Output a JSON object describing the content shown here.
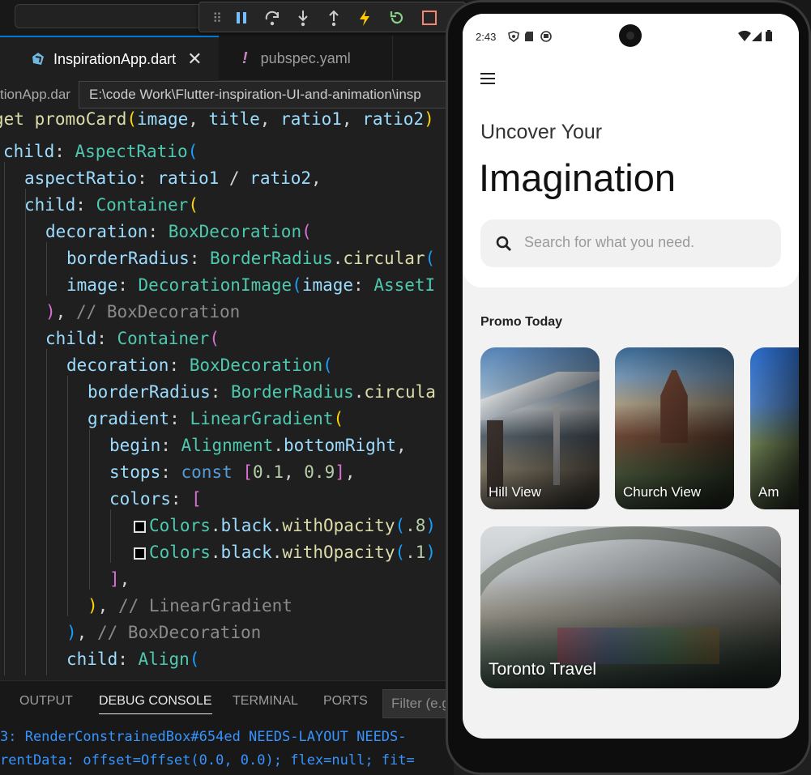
{
  "editor": {
    "tabs": [
      {
        "label": "InspirationApp.dart",
        "active": true
      },
      {
        "label": "pubspec.yaml",
        "active": false
      }
    ],
    "breadcrumb": "tionApp.dar",
    "tooltip": "E:\\code Work\\Flutter-inspiration-UI-and-animation\\insp",
    "code_lines": [
      "get promoCard(image, title, ratio1, ratio2)",
      "child: AspectRatio(",
      "aspectRatio: ratio1 / ratio2,",
      "child: Container(",
      "decoration: BoxDecoration(",
      "borderRadius: BorderRadius.circular(",
      "image: DecorationImage(image: AssetI",
      "), // BoxDecoration",
      "child: Container(",
      "decoration: BoxDecoration(",
      "borderRadius: BorderRadius.circula",
      "gradient: LinearGradient(",
      "begin: Alignment.bottomRight,",
      "stops: const [0.1, 0.9],",
      "colors: [",
      "Colors.black.withOpacity(.8)",
      "Colors.black.withOpacity(.1)",
      "],",
      "), // LinearGradient",
      "), // BoxDecoration",
      "child: Align("
    ],
    "panel_tabs": [
      "OUTPUT",
      "DEBUG CONSOLE",
      "TERMINAL",
      "PORTS"
    ],
    "filter_placeholder": "Filter (e.g",
    "console_lines": [
      "3: RenderConstrainedBox#654ed NEEDS-LAYOUT NEEDS-",
      "rentData: offset=Offset(0.0, 0.0); flex=null; fit="
    ],
    "debug_toolbar_icons": [
      "drag-handle-icon",
      "pause-icon",
      "step-over-icon",
      "step-into-icon",
      "step-out-icon",
      "hot-reload-icon",
      "restart-icon",
      "stop-icon"
    ]
  },
  "phone": {
    "status_time": "2:43",
    "subtitle": "Uncover Your",
    "headline": "Imagination",
    "search_placeholder": "Search for what you need.",
    "section_title": "Promo Today",
    "cards": [
      {
        "label": "Hill View"
      },
      {
        "label": "Church View"
      },
      {
        "label": "Am"
      },
      {
        "label": "Toronto Travel"
      }
    ]
  },
  "colors": {
    "accent": "#0078d4",
    "editor_bg": "#1f1f1f",
    "console_text": "#3794ff",
    "phone_bg": "#f2f2f2"
  }
}
